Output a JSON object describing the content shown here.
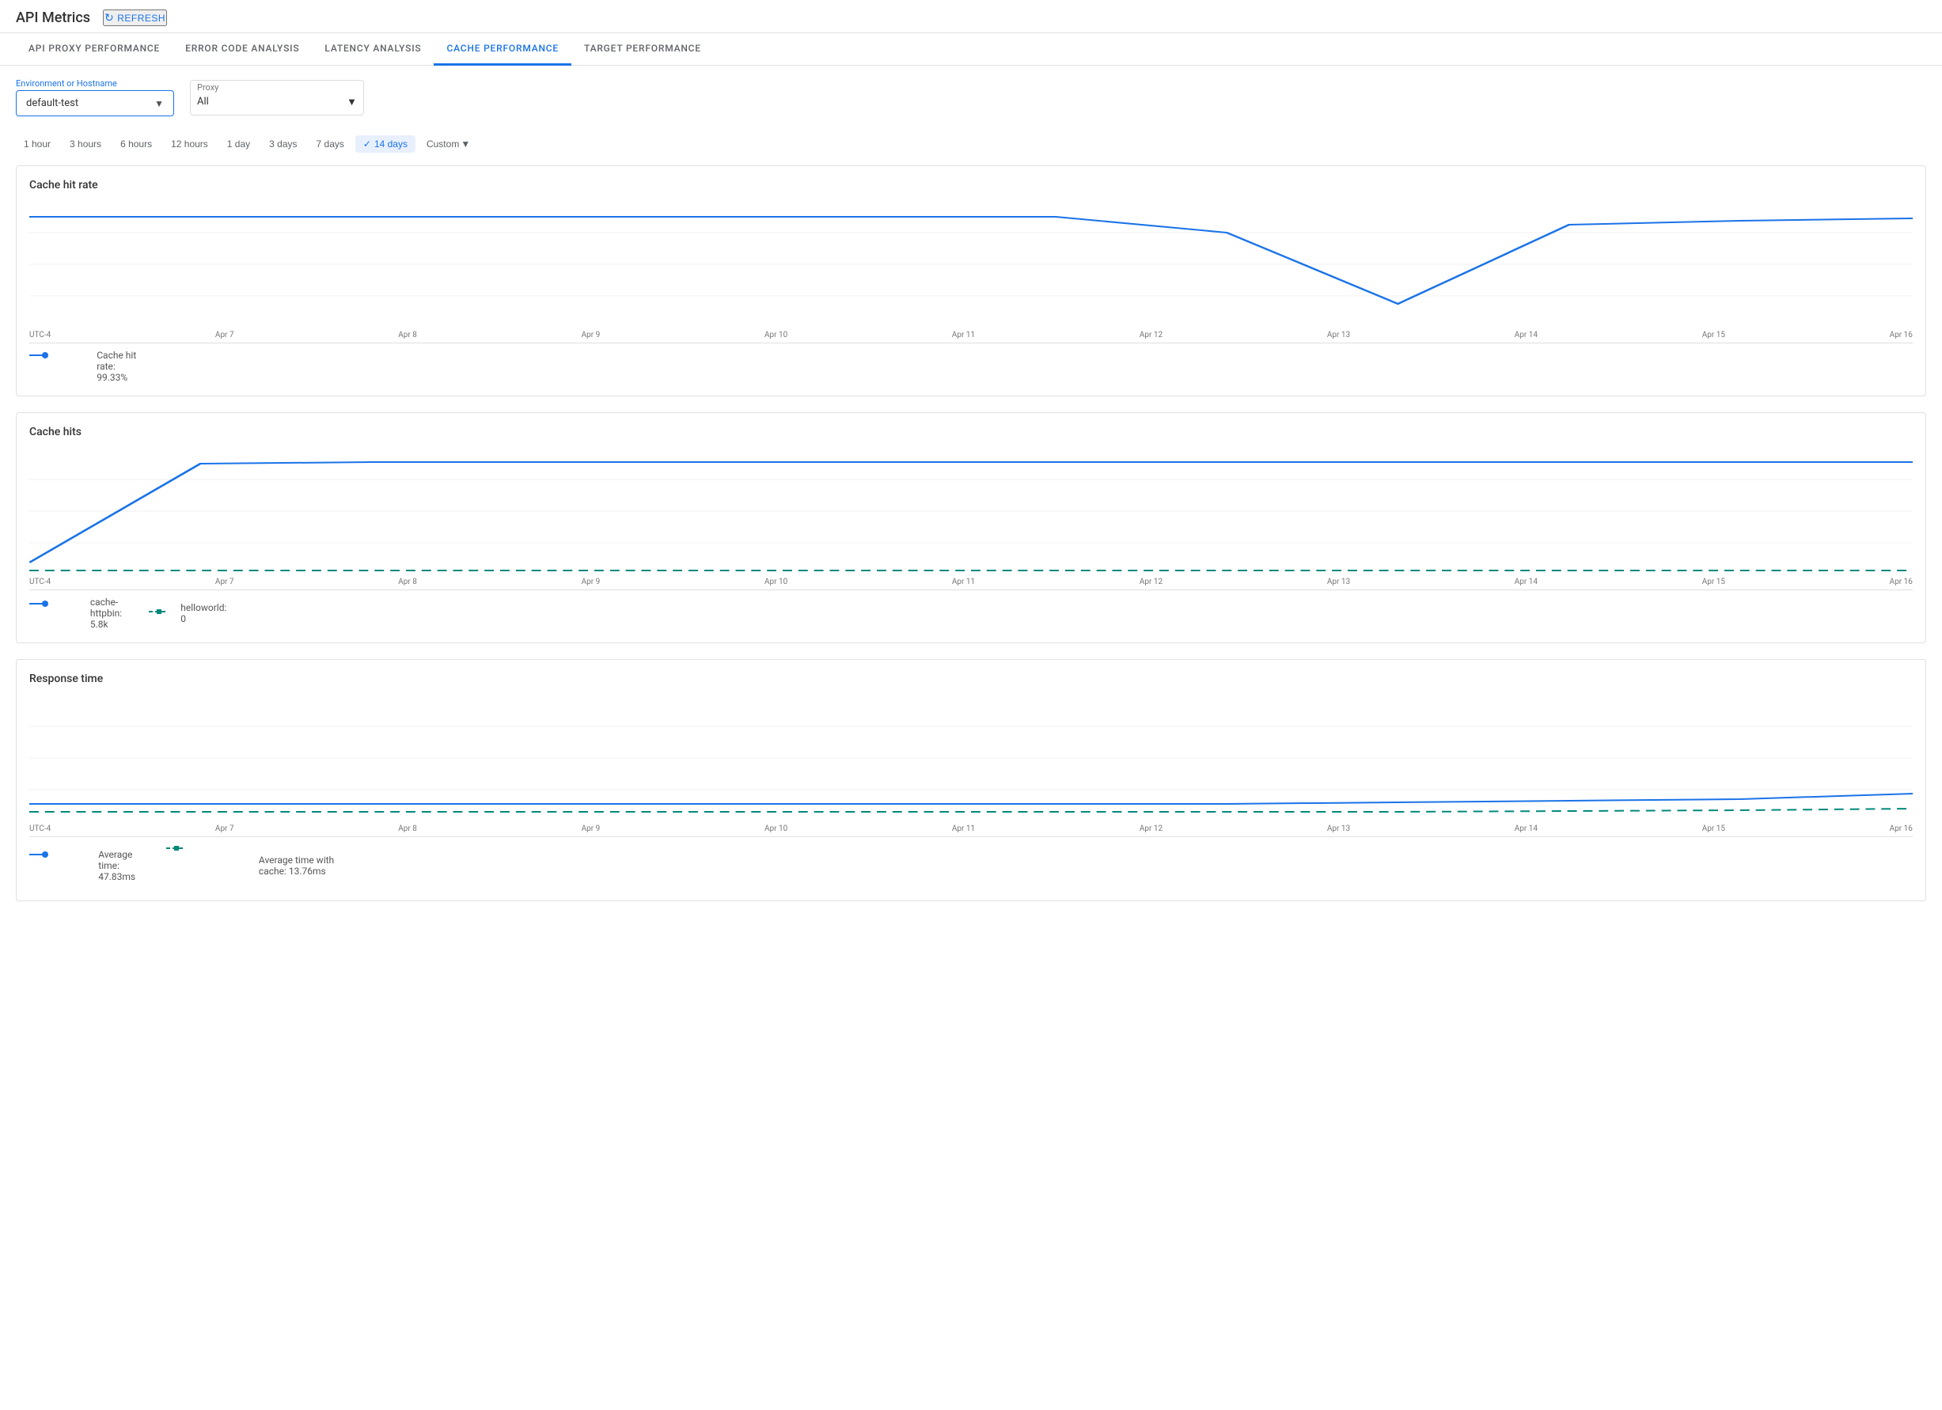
{
  "header": {
    "title": "API Metrics",
    "refresh_label": "REFRESH"
  },
  "tabs": [
    {
      "id": "api-proxy",
      "label": "API PROXY PERFORMANCE",
      "active": false
    },
    {
      "id": "error-code",
      "label": "ERROR CODE ANALYSIS",
      "active": false
    },
    {
      "id": "latency",
      "label": "LATENCY ANALYSIS",
      "active": false
    },
    {
      "id": "cache",
      "label": "CACHE PERFORMANCE",
      "active": true
    },
    {
      "id": "target",
      "label": "TARGET PERFORMANCE",
      "active": false
    }
  ],
  "filters": {
    "environment_label": "Environment or Hostname",
    "environment_value": "default-test",
    "proxy_label": "Proxy",
    "proxy_value": "All"
  },
  "time_filters": {
    "options": [
      {
        "label": "1 hour",
        "active": false
      },
      {
        "label": "3 hours",
        "active": false
      },
      {
        "label": "6 hours",
        "active": false
      },
      {
        "label": "12 hours",
        "active": false
      },
      {
        "label": "1 day",
        "active": false
      },
      {
        "label": "3 days",
        "active": false
      },
      {
        "label": "7 days",
        "active": false
      },
      {
        "label": "14 days",
        "active": true
      },
      {
        "label": "Custom",
        "active": false
      }
    ]
  },
  "charts": {
    "cache_hit_rate": {
      "title": "Cache hit rate",
      "x_labels": [
        "UTC-4",
        "Apr 7",
        "Apr 8",
        "Apr 9",
        "Apr 10",
        "Apr 11",
        "Apr 12",
        "Apr 13",
        "Apr 14",
        "Apr 15",
        "Apr 16"
      ],
      "legend": [
        {
          "type": "line-dot",
          "color": "#1a73e8",
          "label": "Cache hit rate: 99.33%"
        }
      ]
    },
    "cache_hits": {
      "title": "Cache hits",
      "x_labels": [
        "UTC-4",
        "Apr 7",
        "Apr 8",
        "Apr 9",
        "Apr 10",
        "Apr 11",
        "Apr 12",
        "Apr 13",
        "Apr 14",
        "Apr 15",
        "Apr 16"
      ],
      "legend": [
        {
          "type": "line-dot",
          "color": "#1a73e8",
          "label": "cache-httpbin: 5.8k"
        },
        {
          "type": "line-dash",
          "color": "#00897b",
          "label": "helloworld: 0"
        }
      ]
    },
    "response_time": {
      "title": "Response time",
      "x_labels": [
        "UTC-4",
        "Apr 7",
        "Apr 8",
        "Apr 9",
        "Apr 10",
        "Apr 11",
        "Apr 12",
        "Apr 13",
        "Apr 14",
        "Apr 15",
        "Apr 16"
      ],
      "legend": [
        {
          "type": "line-dot",
          "color": "#1a73e8",
          "label": "Average time: 47.83ms"
        },
        {
          "type": "line-dash",
          "color": "#00897b",
          "label": "Average time with cache: 13.76ms"
        }
      ]
    }
  }
}
